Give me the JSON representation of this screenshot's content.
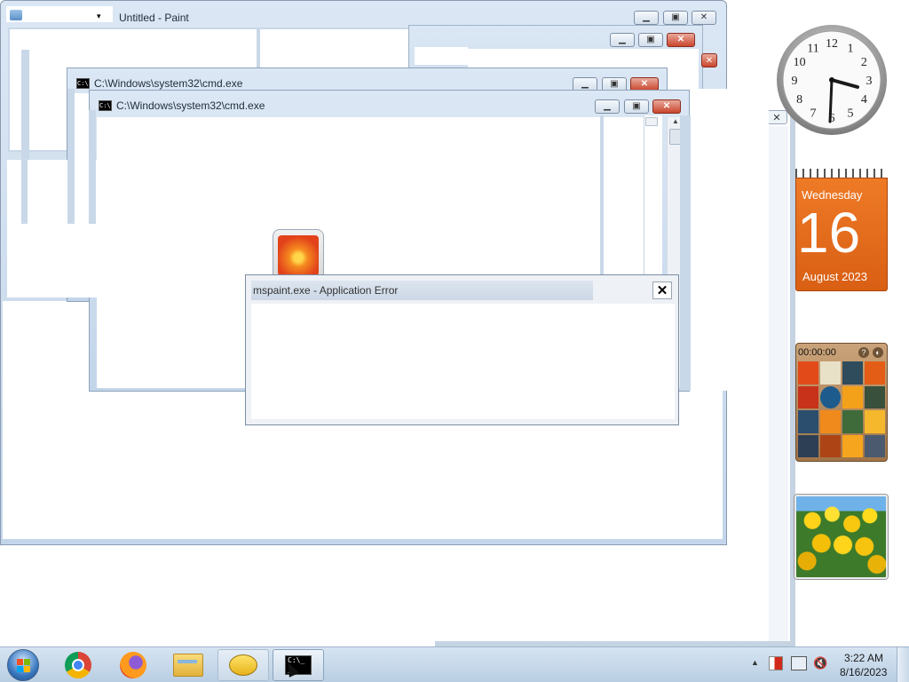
{
  "paint_window": {
    "title": "Untitled - Paint",
    "min_icon": "minimize-icon",
    "max_icon": "maximize-icon",
    "close_icon": "close-icon"
  },
  "cmd_window_back": {
    "title": "C:\\Windows\\system32\\cmd.exe"
  },
  "cmd_window_front": {
    "title": "C:\\Windows\\system32\\cmd.exe"
  },
  "error_dialog": {
    "title": "mspaint.exe - Application Error",
    "close_label": "✕"
  },
  "gadgets": {
    "clock": {
      "numbers": [
        "12",
        "1",
        "2",
        "3",
        "4",
        "5",
        "6",
        "7",
        "8",
        "9",
        "10",
        "11"
      ],
      "time_shown": "3:30"
    },
    "calendar": {
      "weekday": "Wednesday",
      "day": "16",
      "month_year": "August 2023",
      "accent": "#e06a1b"
    },
    "puzzle": {
      "timer": "00:00:00",
      "help_icon": "help-icon",
      "settings_icon": "puzzle-settings-icon"
    },
    "slideshow": {
      "image": "tulips-photo"
    }
  },
  "taskbar": {
    "start_icon": "windows-start-icon",
    "apps": [
      {
        "name": "Google Chrome",
        "icon": "chrome-icon"
      },
      {
        "name": "Firefox",
        "icon": "firefox-icon"
      },
      {
        "name": "Windows Explorer",
        "icon": "folder-icon"
      },
      {
        "name": "Feedback",
        "icon": "speech-bubble-icon"
      },
      {
        "name": "Command Prompt",
        "icon": "cmd-icon"
      }
    ],
    "tray": {
      "show_hidden_icon": "up-arrow-icon",
      "action_center_icon": "flag-icon",
      "network_icon": "network-icon",
      "volume_icon": "volume-muted-icon",
      "time": "3:22 AM",
      "date": "8/16/2023"
    }
  }
}
